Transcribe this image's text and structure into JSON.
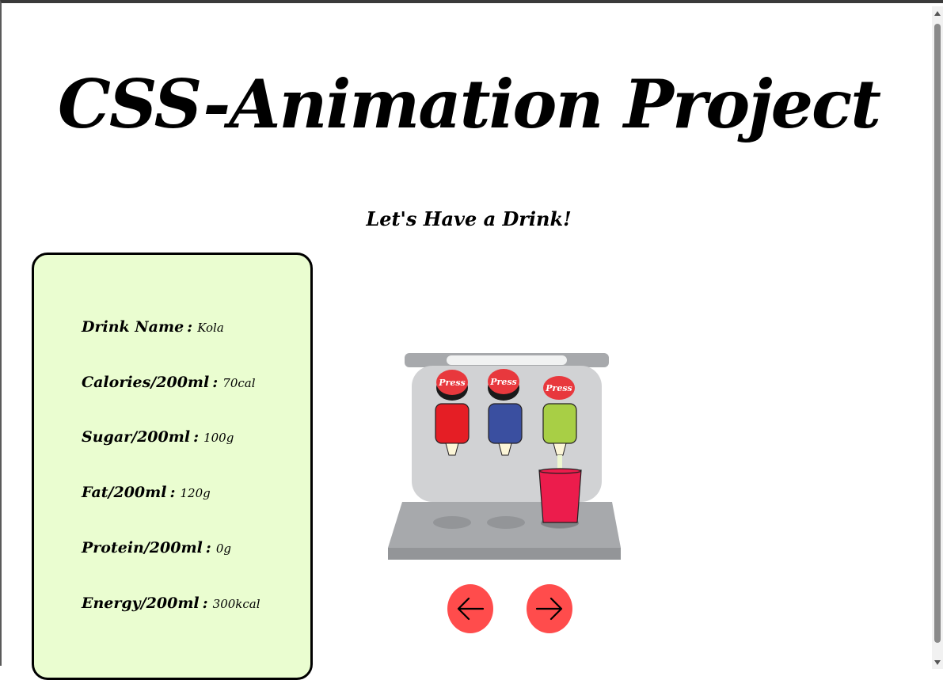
{
  "page": {
    "title": "CSS-Animation Project",
    "subtitle": "Let's Have a Drink!"
  },
  "drink_info": {
    "rows": [
      {
        "label": "Drink Name",
        "value": "Kola"
      },
      {
        "label": "Calories/200ml",
        "value": "70cal"
      },
      {
        "label": "Sugar/200ml",
        "value": "100g"
      },
      {
        "label": "Fat/200ml",
        "value": "120g"
      },
      {
        "label": "Protein/200ml",
        "value": "0g"
      },
      {
        "label": "Energy/200ml",
        "value": "300kcal"
      }
    ],
    "separator": ":"
  },
  "machine": {
    "press_label": "Press",
    "dispensers": [
      {
        "color": "#e51e25",
        "button_color": "#e8383d"
      },
      {
        "color": "#3a4fa0",
        "button_color": "#e8383d"
      },
      {
        "color": "#a8cf45",
        "button_color": "#e8383d"
      }
    ],
    "cup_color": "#ec1c4c",
    "active_dispenser": 3
  },
  "navigation": {
    "prev_icon": "arrow-left-icon",
    "next_icon": "arrow-right-icon"
  },
  "colors": {
    "card_bg": "#eafdd0",
    "nav_button": "#ff4c4c",
    "machine_body": "#d1d2d4",
    "machine_base": "#a7a9ac"
  }
}
